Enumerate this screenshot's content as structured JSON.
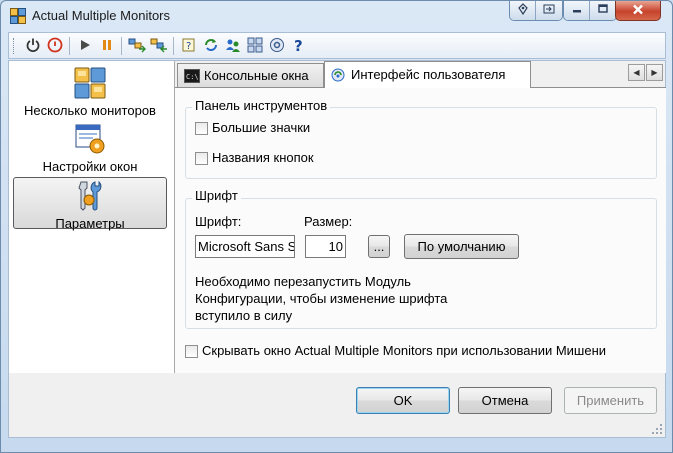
{
  "window": {
    "title": "Actual Multiple Monitors",
    "controls": [
      "pin-icon",
      "restore-to-monitor-icon",
      "minimize-icon",
      "maximize-icon",
      "close-icon"
    ]
  },
  "toolbar": {
    "buttons": [
      "power-icon",
      "stop-icon",
      "play-icon",
      "pause-icon",
      "monitors-export-icon",
      "monitors-import-icon",
      "help-topic-icon",
      "refresh-icon",
      "users-icon",
      "layout-icon",
      "settings-icon",
      "help-icon"
    ]
  },
  "sidebar": {
    "items": [
      {
        "label": "Несколько мониторов",
        "icon": "monitors-grid-icon"
      },
      {
        "label": "Настройки окон",
        "icon": "window-settings-icon"
      },
      {
        "label": "Параметры",
        "icon": "tools-icon"
      }
    ],
    "selected_index": 2
  },
  "tabs": [
    {
      "label": "Консольные окна",
      "icon": "console-icon",
      "active": false
    },
    {
      "label": "Интерфейс пользователя",
      "icon": "user-interface-icon",
      "active": true
    }
  ],
  "toolbar_group": {
    "title": "Панель инструментов",
    "large_icons_label": "Большие значки",
    "large_icons_checked": false,
    "button_names_label": "Названия кнопок",
    "button_names_checked": false
  },
  "font_group": {
    "title": "Шрифт",
    "font_label": "Шрифт:",
    "font_value": "Microsoft Sans Serif",
    "size_label": "Размер:",
    "size_value": "10",
    "browse_label": "...",
    "default_label": "По умолчанию",
    "note_lines": [
      "Необходимо перезапустить Модуль",
      "Конфигурации, чтобы изменение шрифта",
      "вступило в силу"
    ]
  },
  "hide_window": {
    "label": "Скрывать окно Actual Multiple Monitors при использовании Мишени",
    "checked": false
  },
  "buttons": {
    "ok": "OK",
    "cancel": "Отмена",
    "apply": "Применить"
  },
  "colors": {
    "frame": "#c6d9ee",
    "close": "#c7432c",
    "default_button_border": "#3c7fb1"
  }
}
